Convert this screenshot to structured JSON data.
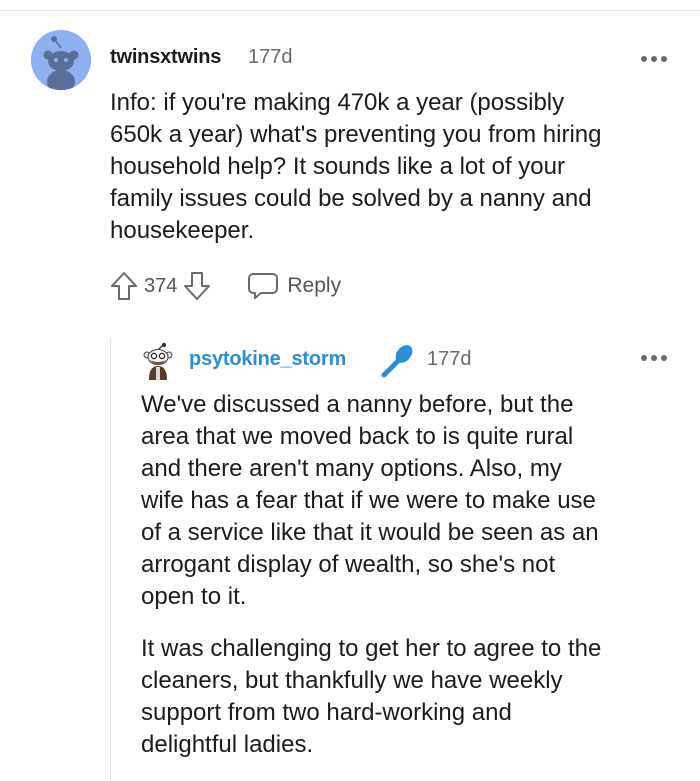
{
  "parent_comment": {
    "username": "twinsxtwins",
    "age": "177d",
    "lines": [
      "Info: if you're making 470k a year (possibly",
      "650k a year) what's preventing you from hiring",
      "household help? It sounds like a lot of your",
      "family issues could be solved by a nanny and",
      "housekeeper."
    ],
    "score": "374",
    "reply_label": "Reply",
    "avatar_icon": "snoo-avatar-icon",
    "avatar_color": "#8fb0f0"
  },
  "reply_comment": {
    "username": "psytokine_storm",
    "age": "177d",
    "username_color": "#2a8fd6",
    "flair_icon": "microphone-icon",
    "paragraph1_lines": [
      "We've discussed a nanny before, but the",
      "area that we moved back to is quite rural",
      "and there aren't many options. Also, my",
      "wife has a fear that if we were to make use",
      "of a service like that it would be seen as an",
      "arrogant display of wealth, so she's not",
      "open to it."
    ],
    "paragraph2_lines": [
      "It was challenging to get her to agree to the",
      "cleaners, but thankfully we have weekly",
      "support from two hard-working and",
      "delightful ladies."
    ]
  }
}
